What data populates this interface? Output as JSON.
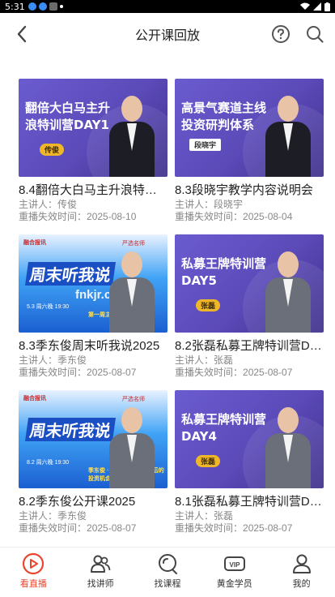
{
  "status_bar": {
    "time": "5:31"
  },
  "header": {
    "title": "公开课回放",
    "back_icon": "back-arrow-icon",
    "help_icon": "help-icon",
    "search_icon": "search-icon"
  },
  "videos": [
    {
      "thumb": {
        "style": "purple",
        "title": "翻倍大白马主升浪特训营DAY1",
        "tag": "传俊"
      },
      "title": "8.4翻倍大白马主升浪特训营DAY1",
      "lecturer_label": "主讲人：",
      "lecturer": "传俊",
      "expiry_label": "重播失效时间：",
      "expiry": "2025-08-10"
    },
    {
      "thumb": {
        "style": "purple",
        "title": "高景气赛道主线投资研判体系",
        "tag": "段晓宇"
      },
      "title": "8.3段晓宇教学内容说明会",
      "lecturer_label": "主讲人：",
      "lecturer": "段晓宇",
      "expiry_label": "重播失效时间：",
      "expiry": "2025-08-04"
    },
    {
      "thumb": {
        "style": "blue",
        "logo": "融合报讯",
        "brand": "严选名师",
        "big": "周末听我说",
        "watermark": "fnkjr.com",
        "sub": "5.3 周六晚 19:30",
        "sub2": "第一周主播话题讨论"
      },
      "title": "8.3季东俊周末听我说2025",
      "lecturer_label": "主讲人：",
      "lecturer": "季东俊",
      "expiry_label": "重播失效时间：",
      "expiry": "2025-08-07"
    },
    {
      "thumb": {
        "style": "purple",
        "title": "私募王牌特训营DAY5",
        "tag": "张磊"
      },
      "title": "8.2张磊私募王牌特训营DAY5",
      "lecturer_label": "主讲人：",
      "lecturer": "张磊",
      "expiry_label": "重播失效时间：",
      "expiry": "2025-08-07"
    },
    {
      "thumb": {
        "style": "blue",
        "logo": "融合报讯",
        "brand": "严选名师",
        "big": "周末听我说",
        "watermark": "",
        "sub": "8.2 周六晚 19:30",
        "sub2": "季东俊 · 价值投资 3600点后的投资机会"
      },
      "title": "8.2季东俊公开课2025",
      "lecturer_label": "主讲人：",
      "lecturer": "季东俊",
      "expiry_label": "重播失效时间：",
      "expiry": "2025-08-07"
    },
    {
      "thumb": {
        "style": "purple",
        "title": "私募王牌特训营DAY4",
        "tag": "张磊"
      },
      "title": "8.1张磊私募王牌特训营DAY4",
      "lecturer_label": "主讲人：",
      "lecturer": "张磊",
      "expiry_label": "重播失效时间：",
      "expiry": "2025-08-07"
    }
  ],
  "tabbar": [
    {
      "label": "看直播",
      "icon": "play-circle-icon",
      "active": true
    },
    {
      "label": "找讲师",
      "icon": "people-icon",
      "active": false
    },
    {
      "label": "找课程",
      "icon": "course-search-icon",
      "active": false
    },
    {
      "label": "黄金学员",
      "icon": "vip-icon",
      "active": false
    },
    {
      "label": "我的",
      "icon": "profile-icon",
      "active": false
    }
  ],
  "colors": {
    "accent": "#e8462e",
    "thumb_purple": "#5b4ab8",
    "thumb_blue": "#1b5fd1",
    "tag_gold": "#f0b629"
  }
}
